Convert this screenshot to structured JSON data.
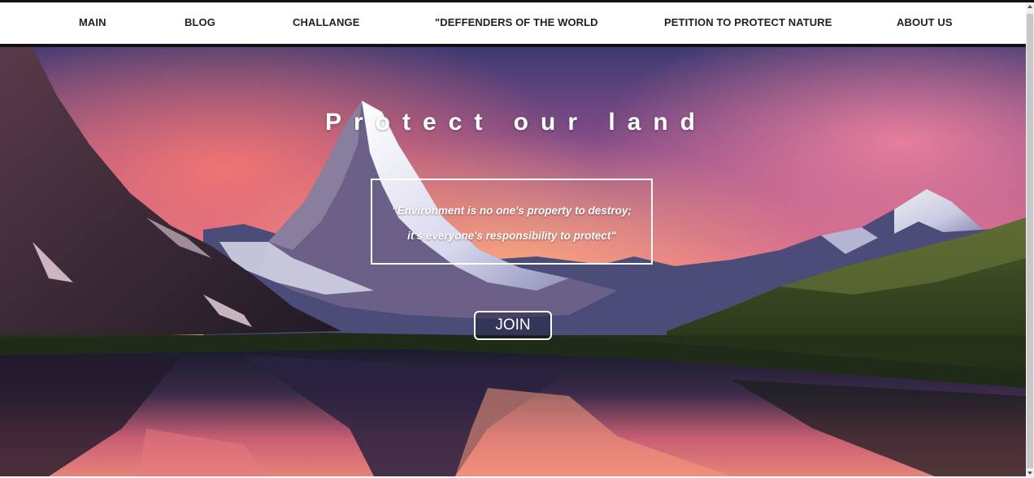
{
  "nav": {
    "items": [
      {
        "label": "MAIN"
      },
      {
        "label": "BLOG"
      },
      {
        "label": "CHALLANGE"
      },
      {
        "label": "\"DEFFENDERS OF THE WORLD"
      },
      {
        "label": "PETITION TO PROTECT NATURE"
      },
      {
        "label": "ABOUT US"
      }
    ]
  },
  "hero": {
    "title": "Protect our land",
    "quote_line_1": "\"Environment is no one's property to destroy;",
    "quote_line_2": "it's everyone's responsibility to protect\"",
    "join_label": "JOIN"
  },
  "colors": {
    "nav_background": "#ffffff",
    "nav_text": "#222222",
    "hero_text": "#ffffff"
  }
}
